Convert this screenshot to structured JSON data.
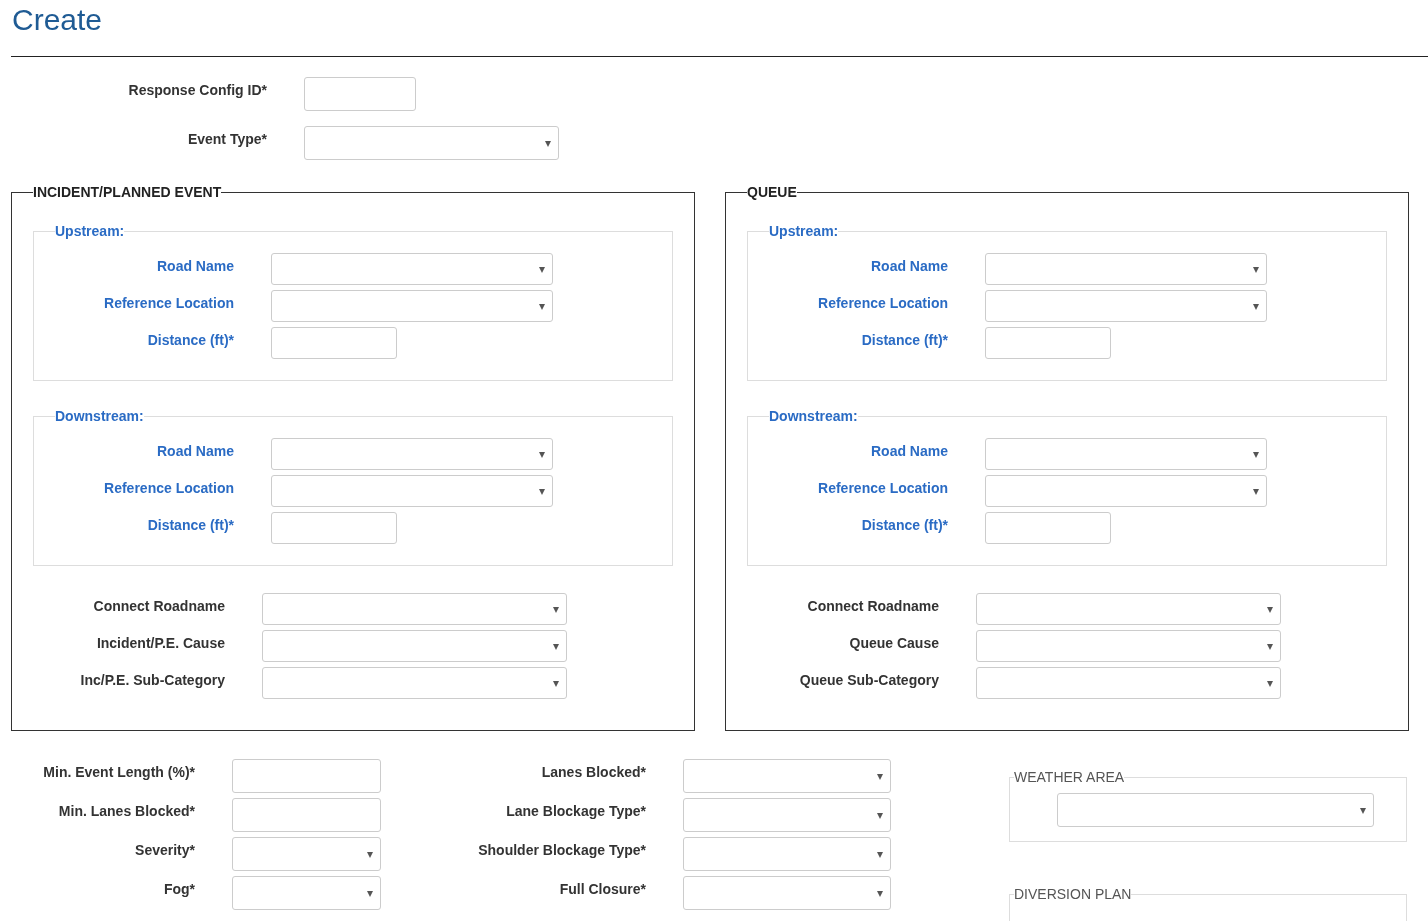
{
  "title": "Create",
  "top_fields": [
    {
      "label": "Response Config ID*",
      "kind": "text"
    },
    {
      "label": "Event Type*",
      "kind": "select"
    }
  ],
  "panels": [
    {
      "legend": "INCIDENT/PLANNED EVENT",
      "groups": [
        {
          "legend": "Upstream:",
          "fields": [
            {
              "label": "Road Name",
              "kind": "select"
            },
            {
              "label": "Reference Location",
              "kind": "select"
            },
            {
              "label": "Distance (ft)*",
              "kind": "text"
            }
          ]
        },
        {
          "legend": "Downstream:",
          "fields": [
            {
              "label": "Road Name",
              "kind": "select"
            },
            {
              "label": "Reference Location",
              "kind": "select"
            },
            {
              "label": "Distance (ft)*",
              "kind": "text"
            }
          ]
        }
      ],
      "fields": [
        {
          "label": "Connect Roadname",
          "kind": "select"
        },
        {
          "label": "Incident/P.E. Cause",
          "kind": "select"
        },
        {
          "label": "Inc/P.E. Sub-Category",
          "kind": "select"
        }
      ]
    },
    {
      "legend": "QUEUE",
      "groups": [
        {
          "legend": "Upstream:",
          "fields": [
            {
              "label": "Road Name",
              "kind": "select"
            },
            {
              "label": "Reference Location",
              "kind": "select"
            },
            {
              "label": "Distance (ft)*",
              "kind": "text"
            }
          ]
        },
        {
          "legend": "Downstream:",
          "fields": [
            {
              "label": "Road Name",
              "kind": "select"
            },
            {
              "label": "Reference Location",
              "kind": "select"
            },
            {
              "label": "Distance (ft)*",
              "kind": "text"
            }
          ]
        }
      ],
      "fields": [
        {
          "label": "Connect Roadname",
          "kind": "select"
        },
        {
          "label": "Queue Cause",
          "kind": "select"
        },
        {
          "label": "Queue Sub-Category",
          "kind": "select"
        }
      ]
    }
  ],
  "bottom_left": [
    {
      "label": "Min. Event Length (%)*",
      "kind": "text"
    },
    {
      "label": "Min. Lanes Blocked*",
      "kind": "text"
    },
    {
      "label": "Severity*",
      "kind": "select"
    },
    {
      "label": "Fog*",
      "kind": "select"
    }
  ],
  "bottom_middle": [
    {
      "label": "Lanes Blocked*",
      "kind": "select"
    },
    {
      "label": "Lane Blockage Type*",
      "kind": "select"
    },
    {
      "label": "Shoulder Blockage Type*",
      "kind": "select"
    },
    {
      "label": "Full Closure*",
      "kind": "select"
    }
  ],
  "side_sections": [
    {
      "legend": "WEATHER AREA",
      "fields": [
        {
          "kind": "select"
        }
      ]
    },
    {
      "legend": "DIVERSION PLAN"
    }
  ]
}
